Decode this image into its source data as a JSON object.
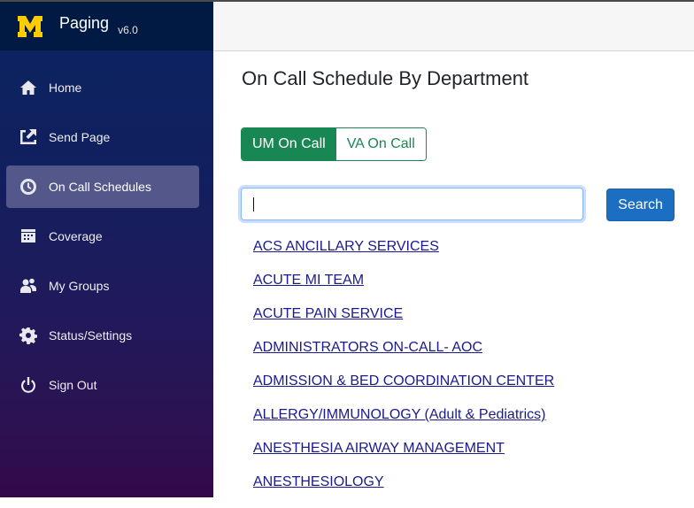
{
  "app": {
    "title": "Paging",
    "version": "v6.0",
    "logo_letter": "M",
    "logo_color": "#ffcb05"
  },
  "sidebar": {
    "items": [
      {
        "label": "Home",
        "icon": "home-icon",
        "active": false
      },
      {
        "label": "Send Page",
        "icon": "send-page-icon",
        "active": false
      },
      {
        "label": "On Call Schedules",
        "icon": "clock-icon",
        "active": true
      },
      {
        "label": "Coverage",
        "icon": "calendar-icon",
        "active": false
      },
      {
        "label": "My Groups",
        "icon": "users-icon",
        "active": false
      },
      {
        "label": "Status/Settings",
        "icon": "gear-icon",
        "active": false
      },
      {
        "label": "Sign Out",
        "icon": "power-icon",
        "active": false
      }
    ]
  },
  "main": {
    "page_title": "On Call Schedule By Department",
    "toggle": {
      "options": [
        "UM On Call",
        "VA On Call"
      ],
      "selected": "UM On Call"
    },
    "search": {
      "value": "",
      "placeholder": "",
      "button_label": "Search"
    },
    "departments": [
      "ACS ANCILLARY SERVICES",
      "ACUTE MI TEAM",
      "ACUTE PAIN SERVICE",
      "ADMINISTRATORS ON-CALL- AOC",
      "ADMISSION & BED COORDINATION CENTER",
      "ALLERGY/IMMUNOLOGY (Adult & Pediatrics)",
      "ANESTHESIA AIRWAY MANAGEMENT",
      "ANESTHESIOLOGY"
    ]
  },
  "colors": {
    "primary_green": "#198754",
    "search_blue": "#1b6ec2",
    "link": "#1a1a8c",
    "active_nav": "#53578a",
    "brand_bar": "#011a43"
  }
}
